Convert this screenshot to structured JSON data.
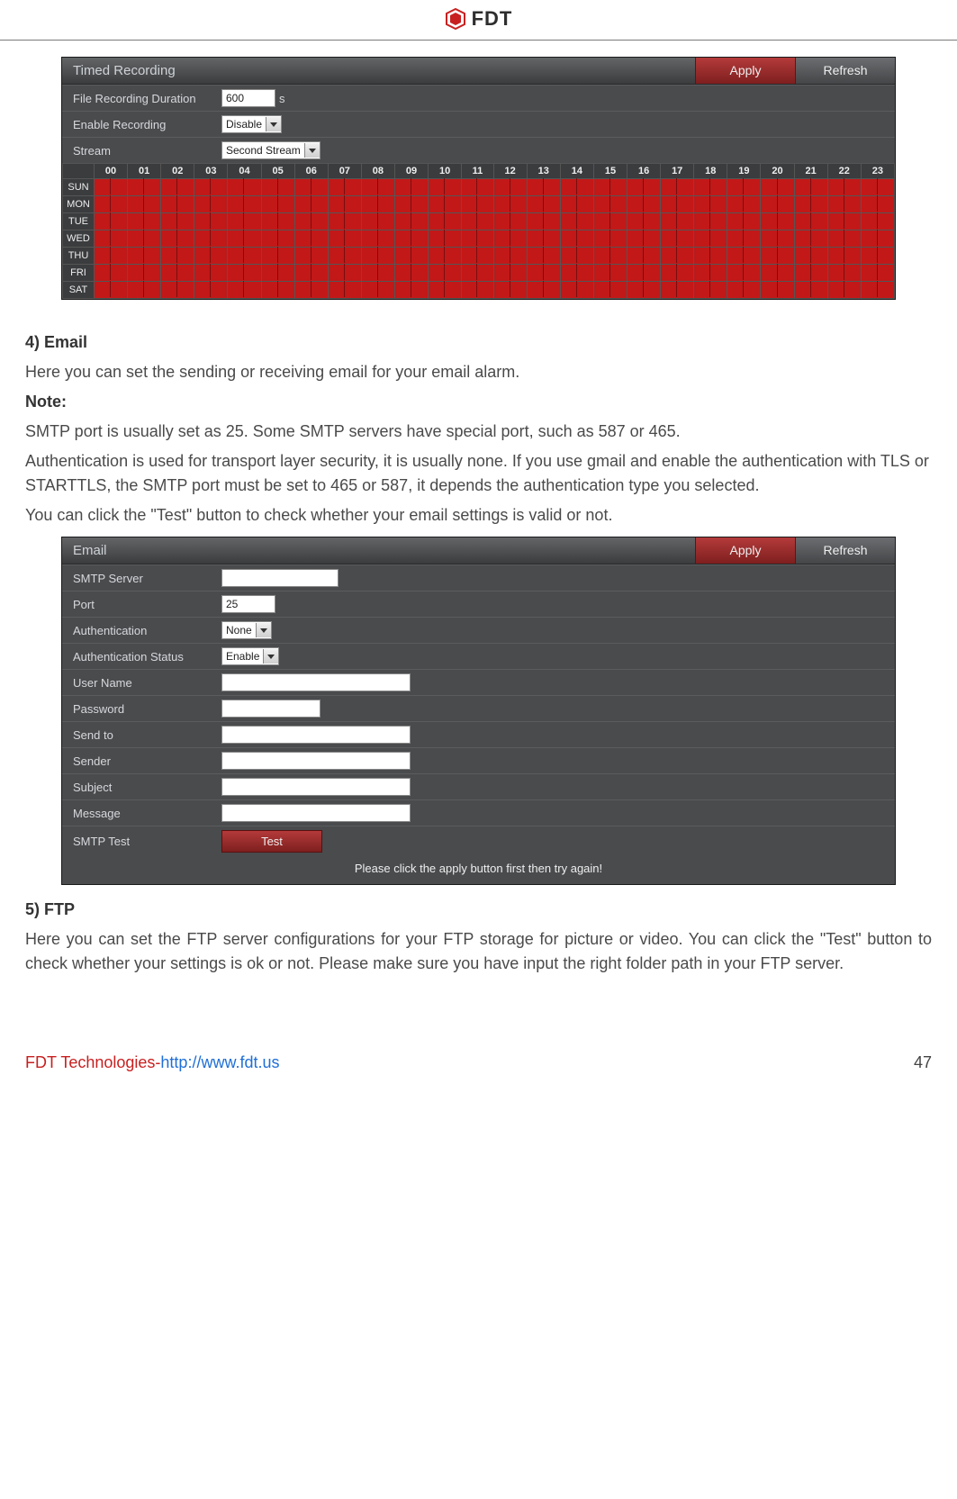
{
  "header": {
    "brand": "FDT"
  },
  "panel1": {
    "title": "Timed Recording",
    "apply": "Apply",
    "refresh": "Refresh",
    "rows": {
      "duration_label": "File Recording Duration",
      "duration_value": "600",
      "duration_unit": "s",
      "enable_label": "Enable Recording",
      "enable_value": "Disable",
      "stream_label": "Stream",
      "stream_value": "Second Stream"
    },
    "schedule": {
      "hours": [
        "00",
        "01",
        "02",
        "03",
        "04",
        "05",
        "06",
        "07",
        "08",
        "09",
        "10",
        "11",
        "12",
        "13",
        "14",
        "15",
        "16",
        "17",
        "18",
        "19",
        "20",
        "21",
        "22",
        "23"
      ],
      "days": [
        "SUN",
        "MON",
        "TUE",
        "WED",
        "THU",
        "FRI",
        "SAT"
      ]
    }
  },
  "section_email": {
    "heading": "4) Email",
    "p1": "Here you can set the sending or receiving email for your email alarm.",
    "note_label": "Note:",
    "p2": "SMTP port is usually set as 25. Some SMTP servers have special port, such as 587 or 465.",
    "p3": "Authentication is used for transport layer security, it is usually none. If you use gmail and enable the authentication with TLS or STARTTLS, the SMTP port must be set to 465 or 587, it depends the authentication type you selected.",
    "p4": "You can click the \"Test\" button to check whether your email settings is valid or not."
  },
  "panel2": {
    "title": "Email",
    "apply": "Apply",
    "refresh": "Refresh",
    "rows": {
      "smtp_server": "SMTP Server",
      "port": "Port",
      "port_value": "25",
      "auth": "Authentication",
      "auth_value": "None",
      "auth_status": "Authentication Status",
      "auth_status_value": "Enable",
      "user": "User Name",
      "pass": "Password",
      "sendto": "Send to",
      "sender": "Sender",
      "subject": "Subject",
      "message": "Message",
      "smtp_test": "SMTP Test",
      "test_btn": "Test",
      "help": "Please click the apply button first then try again!"
    }
  },
  "section_ftp": {
    "heading": "5) FTP",
    "p1": "Here you can set the FTP server configurations for your FTP storage for picture or video. You can click the \"Test\" button to check whether your settings is ok or not. Please make sure you have input the right folder path in your FTP server."
  },
  "footer": {
    "company": "FDT Technologies-",
    "url": "http://www.fdt.us",
    "page": "47"
  }
}
